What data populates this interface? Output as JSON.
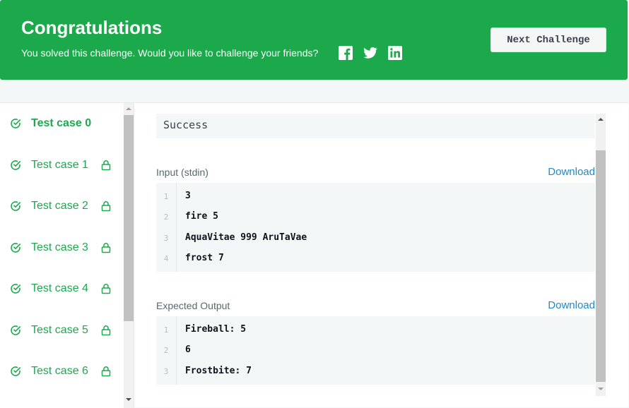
{
  "banner": {
    "title": "Congratulations",
    "subtitle": "You solved this challenge. Would you like to challenge your friends?",
    "next_button": "Next Challenge",
    "share_icons": [
      "facebook-icon",
      "twitter-icon",
      "linkedin-icon"
    ],
    "color": "#1ba94c"
  },
  "sidebar": {
    "test_cases": [
      {
        "label": "Test case 0",
        "active": true,
        "locked": false
      },
      {
        "label": "Test case 1",
        "active": false,
        "locked": true
      },
      {
        "label": "Test case 2",
        "active": false,
        "locked": true
      },
      {
        "label": "Test case 3",
        "active": false,
        "locked": true
      },
      {
        "label": "Test case 4",
        "active": false,
        "locked": true
      },
      {
        "label": "Test case 5",
        "active": false,
        "locked": true
      },
      {
        "label": "Test case 6",
        "active": false,
        "locked": true
      }
    ]
  },
  "result": {
    "status": "Success",
    "input": {
      "label": "Input (stdin)",
      "download": "Download",
      "lines": [
        {
          "n": "1",
          "text": "3"
        },
        {
          "n": "2",
          "text": "fire 5"
        },
        {
          "n": "3",
          "text": "AquaVitae 999 AruTaVae"
        },
        {
          "n": "4",
          "text": "frost 7"
        }
      ]
    },
    "expected": {
      "label": "Expected Output",
      "download": "Download",
      "lines": [
        {
          "n": "1",
          "text": "Fireball: 5"
        },
        {
          "n": "2",
          "text": "6"
        },
        {
          "n": "3",
          "text": "Frostbite: 7"
        }
      ]
    }
  }
}
